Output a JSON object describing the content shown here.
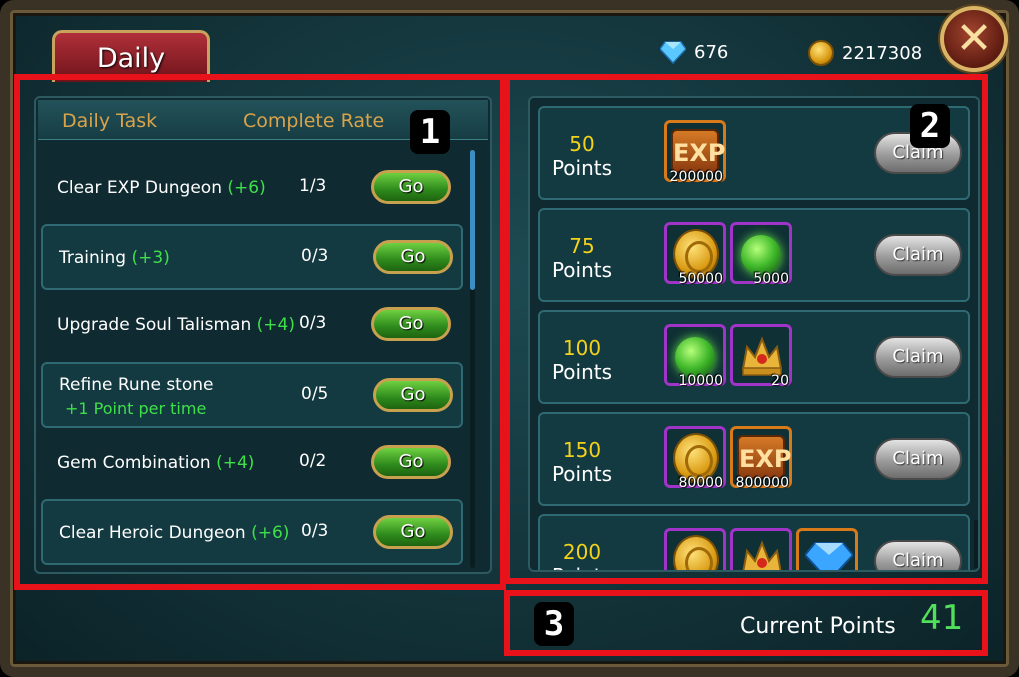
{
  "header": {
    "tab_label": "Daily",
    "diamonds": "676",
    "gold": "2217308",
    "close_icon": "close-x-icon"
  },
  "annotations": [
    "1",
    "2",
    "3"
  ],
  "tasks": {
    "header_task": "Daily Task",
    "header_rate": "Complete Rate",
    "go_label": "Go",
    "items": [
      {
        "name": "Clear EXP Dungeon",
        "bonus": "(+6)",
        "sub": "",
        "rate": "1/3"
      },
      {
        "name": "Training",
        "bonus": "(+3)",
        "sub": "",
        "rate": "0/3"
      },
      {
        "name": "Upgrade Soul Talisman",
        "bonus": "(+4)",
        "sub": "",
        "rate": "0/3"
      },
      {
        "name": "Refine Rune stone",
        "bonus": "",
        "sub": "+1 Point per time",
        "rate": "0/5"
      },
      {
        "name": "Gem Combination",
        "bonus": "(+4)",
        "sub": "",
        "rate": "0/2"
      },
      {
        "name": "Clear Heroic Dungeon",
        "bonus": "(+6)",
        "sub": "",
        "rate": "0/3"
      }
    ]
  },
  "rewards": {
    "claim_label": "Claim",
    "points_label": "Points",
    "items": [
      {
        "points": "50",
        "items": [
          {
            "icon": "exp-icon",
            "count": "200000"
          }
        ]
      },
      {
        "points": "75",
        "items": [
          {
            "icon": "gold-coin-icon",
            "count": "50000"
          },
          {
            "icon": "green-orb-icon",
            "count": "5000"
          }
        ]
      },
      {
        "points": "100",
        "items": [
          {
            "icon": "green-orb-icon",
            "count": "10000"
          },
          {
            "icon": "crown-icon",
            "count": "20"
          }
        ]
      },
      {
        "points": "150",
        "items": [
          {
            "icon": "gold-coin-icon",
            "count": "80000"
          },
          {
            "icon": "exp-icon",
            "count": "800000"
          }
        ]
      },
      {
        "points": "200",
        "items": [
          {
            "icon": "gold-coin-icon",
            "count": ""
          },
          {
            "icon": "crown-icon",
            "count": ""
          },
          {
            "icon": "blue-gem-icon",
            "count": ""
          }
        ]
      }
    ]
  },
  "footer": {
    "current_points_label": "Current Points",
    "current_points_value": "41"
  },
  "colors": {
    "annotation_red": "#e8131a",
    "points_yellow": "#f2d21a",
    "bonus_green": "#3ee04a",
    "go_green": "#2e8a1c"
  }
}
